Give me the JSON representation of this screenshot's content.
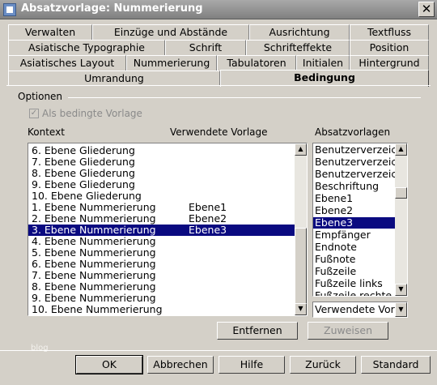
{
  "window": {
    "title": "Absatzvorlage: Nummerierung",
    "close_symbol": "✕"
  },
  "tabs": {
    "row1": [
      "Verwalten",
      "Einzüge und Abstände",
      "Ausrichtung",
      "Textfluss"
    ],
    "row2": [
      "Asiatische Typographie",
      "Schrift",
      "Schrifteffekte",
      "Position"
    ],
    "row3": [
      "Asiatisches Layout",
      "Nummerierung",
      "Tabulatoren",
      "Initialen",
      "Hintergrund"
    ],
    "row4": [
      "Umrandung",
      "Bedingung"
    ],
    "active": "Bedingung"
  },
  "options": {
    "group_title": "Optionen",
    "conditional_checkbox_label": "Als bedingte Vorlage",
    "conditional_checked": true
  },
  "context_list": {
    "header_context": "Kontext",
    "header_style": "Verwendete Vorlage",
    "rows": [
      {
        "context": "6. Ebene Gliederung",
        "style": ""
      },
      {
        "context": "7. Ebene Gliederung",
        "style": ""
      },
      {
        "context": "8. Ebene Gliederung",
        "style": ""
      },
      {
        "context": "9. Ebene Gliederung",
        "style": ""
      },
      {
        "context": "10. Ebene Gliederung",
        "style": ""
      },
      {
        "context": "1. Ebene Nummerierung",
        "style": "Ebene1"
      },
      {
        "context": "2. Ebene Nummerierung",
        "style": "Ebene2"
      },
      {
        "context": "3. Ebene Nummerierung",
        "style": "Ebene3"
      },
      {
        "context": "4. Ebene Nummerierung",
        "style": ""
      },
      {
        "context": "5. Ebene Nummerierung",
        "style": ""
      },
      {
        "context": "6. Ebene Nummerierung",
        "style": ""
      },
      {
        "context": "7. Ebene Nummerierung",
        "style": ""
      },
      {
        "context": "8. Ebene Nummerierung",
        "style": ""
      },
      {
        "context": "9. Ebene Nummerierung",
        "style": ""
      },
      {
        "context": "10. Ebene Nummerierung",
        "style": ""
      }
    ],
    "selected_index": 7
  },
  "styles_list": {
    "header": "Absatzvorlagen",
    "items": [
      "Benutzerverzeic",
      "Benutzerverzeic",
      "Benutzerverzeic",
      "Beschriftung",
      "Ebene1",
      "Ebene2",
      "Ebene3",
      "Empfänger",
      "Endnote",
      "Fußnote",
      "Fußzeile",
      "Fußzeile links",
      "Fußzeile rechte"
    ],
    "selected_index": 6
  },
  "filter_combo": {
    "value": "Verwendete Vorlagen"
  },
  "actions": {
    "remove_label": "Entfernen",
    "assign_label": "Zuweisen"
  },
  "footer": {
    "ok_label": "OK",
    "cancel_label": "Abbrechen",
    "help_label": "Hilfe",
    "back_label": "Zurück",
    "default_label": "Standard"
  },
  "watermark": "blog",
  "colors": {
    "selection": "#0a0a80",
    "dialog_bg": "#d4d0c8"
  }
}
